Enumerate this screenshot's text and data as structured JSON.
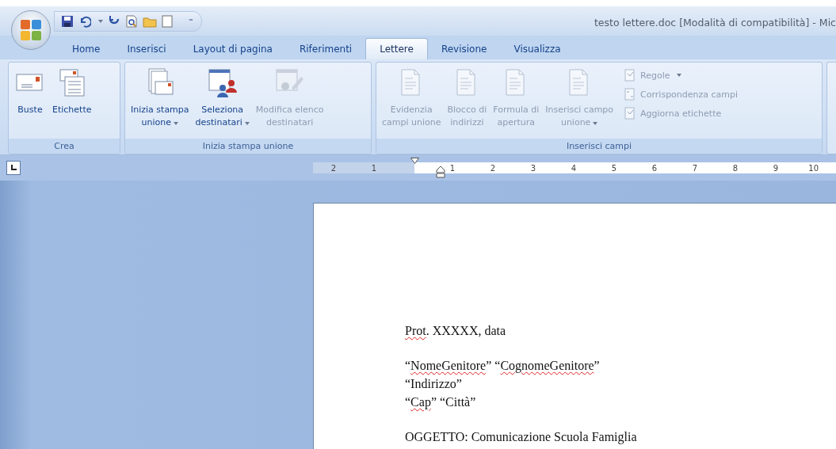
{
  "window": {
    "title": "testo lettere.doc [Modalità di compatibilità] - Mic"
  },
  "quick_access": {
    "more": "⁼"
  },
  "tabs": [
    {
      "label": "Home",
      "selected": false
    },
    {
      "label": "Inserisci",
      "selected": false
    },
    {
      "label": "Layout di pagina",
      "selected": false
    },
    {
      "label": "Riferimenti",
      "selected": false
    },
    {
      "label": "Lettere",
      "selected": true
    },
    {
      "label": "Revisione",
      "selected": false
    },
    {
      "label": "Visualizza",
      "selected": false
    }
  ],
  "ribbon": {
    "groups": [
      {
        "label": "Crea",
        "items": [
          {
            "kind": "large",
            "lines": [
              "Buste"
            ],
            "dropdown": false,
            "disabled": false
          },
          {
            "kind": "large",
            "lines": [
              "Etichette"
            ],
            "dropdown": false,
            "disabled": false
          }
        ]
      },
      {
        "label": "Inizia stampa unione",
        "items": [
          {
            "kind": "large",
            "lines": [
              "Inizia stampa",
              "unione"
            ],
            "dropdown": true,
            "disabled": false
          },
          {
            "kind": "large",
            "lines": [
              "Seleziona",
              "destinatari"
            ],
            "dropdown": true,
            "disabled": false
          },
          {
            "kind": "large",
            "lines": [
              "Modifica elenco",
              "destinatari"
            ],
            "dropdown": false,
            "disabled": true
          }
        ]
      },
      {
        "label": "Inserisci campi",
        "items": [
          {
            "kind": "large",
            "lines": [
              "Evidenzia",
              "campi unione"
            ],
            "dropdown": false,
            "disabled": true
          },
          {
            "kind": "large",
            "lines": [
              "Blocco di",
              "indirizzi"
            ],
            "dropdown": false,
            "disabled": true
          },
          {
            "kind": "large",
            "lines": [
              "Formula di",
              "apertura"
            ],
            "dropdown": false,
            "disabled": true
          },
          {
            "kind": "large",
            "lines": [
              "Inserisci campo",
              "unione"
            ],
            "dropdown": true,
            "disabled": true
          },
          {
            "kind": "small",
            "lines": [
              "Regole"
            ],
            "dropdown": true,
            "disabled": true
          },
          {
            "kind": "small",
            "lines": [
              "Corrispondenza campi"
            ],
            "dropdown": false,
            "disabled": true
          },
          {
            "kind": "small",
            "lines": [
              "Aggiorna etichette"
            ],
            "dropdown": false,
            "disabled": true
          }
        ]
      }
    ]
  },
  "ruler": {
    "left_numbers": [
      "2",
      "1"
    ],
    "numbers": [
      "1",
      "2",
      "3",
      "4",
      "5",
      "6",
      "7",
      "8",
      "9",
      "10"
    ]
  },
  "document": {
    "paragraphs": [
      {
        "lines": [
          {
            "segments": [
              {
                "text": "Prot",
                "misspelled": true
              },
              {
                "text": ". XXXXX, data",
                "misspelled": false
              }
            ]
          }
        ]
      },
      {
        "lines": [
          {
            "segments": [
              {
                "text": "“",
                "misspelled": false
              },
              {
                "text": "NomeGenitore",
                "misspelled": true
              },
              {
                "text": "” “",
                "misspelled": false
              },
              {
                "text": "CognomeGenitore",
                "misspelled": true
              },
              {
                "text": "”",
                "misspelled": false
              }
            ]
          },
          {
            "segments": [
              {
                "text": "“Indirizzo”",
                "misspelled": false
              }
            ]
          },
          {
            "segments": [
              {
                "text": "“",
                "misspelled": false
              },
              {
                "text": "Cap",
                "misspelled": true
              },
              {
                "text": "” “Città”",
                "misspelled": false
              }
            ]
          }
        ]
      },
      {
        "lines": [
          {
            "segments": [
              {
                "text": "OGGETTO: Comunicazione Scuola Famiglia",
                "misspelled": false
              }
            ]
          }
        ]
      }
    ]
  }
}
